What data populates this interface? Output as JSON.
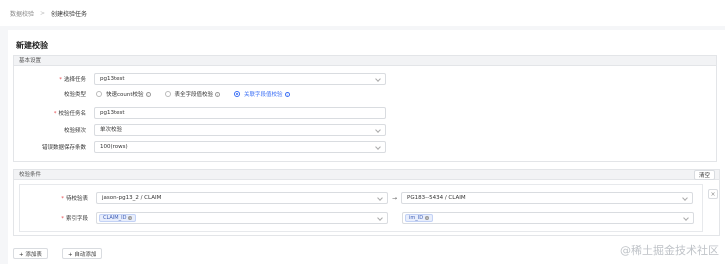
{
  "breadcrumb": {
    "parent": "数据校验",
    "current": "创建校验任务"
  },
  "page_title": "新建校验",
  "basic": {
    "header": "基本设置",
    "task_label": "选择任务",
    "task_value": "pg13test",
    "type_label": "校验类型",
    "type_options": [
      "快速count校验",
      "表全字段值校验",
      "关联字段值校验"
    ],
    "type_selected": "关联字段值校验",
    "name_label": "校验任务名",
    "name_value": "pg13test",
    "freq_label": "校验频次",
    "freq_value": "单次校验",
    "err_label": "错误数据保存条数",
    "err_value": "100(rows)"
  },
  "cond": {
    "header": "校验条件",
    "clear_label": "清空",
    "table_label": "待校验表",
    "source_table": "jason-pg13_2 / CLAIM",
    "target_table": "PG183--5434 / CLAIM",
    "arrow": "→",
    "index_label": "索引字段",
    "source_tag": "CLAIM_ID",
    "target_tag": "im_ID",
    "remove": "×"
  },
  "footer": {
    "add_table": "+ 添加表",
    "auto_add": "+ 自动添加"
  },
  "watermark": "@稀土掘金技术社区",
  "info_icon": "i",
  "tag_close": "×"
}
